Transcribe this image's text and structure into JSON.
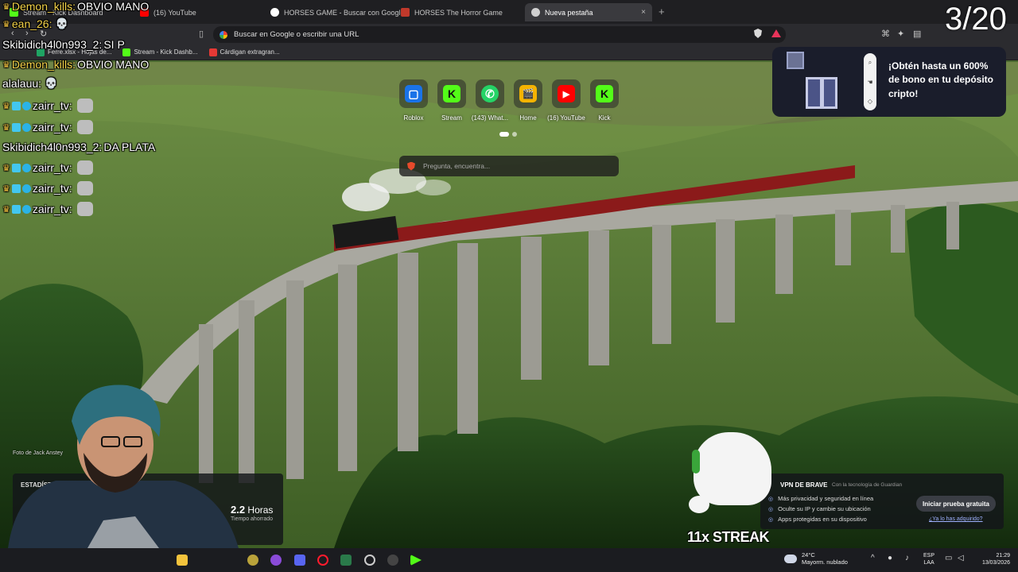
{
  "browser": {
    "tabs": [
      {
        "label": "Stream - Kick Dashboard",
        "favicon_color": "#53fc18"
      },
      {
        "label": "(16) YouTube",
        "favicon_color": "#ff0000"
      },
      {
        "label": "HORSES GAME - Buscar con Google",
        "favicon_color": "#4285f4"
      },
      {
        "label": "HORSES The Horror Game",
        "favicon_color": "#c0392b"
      },
      {
        "label": "Nueva pestaña",
        "favicon_color": "#d0d0d0",
        "active": true
      }
    ],
    "new_tab_symbol": "+",
    "close_symbol": "×",
    "url_placeholder": "Buscar en Google o escribir una URL",
    "bookmarks": [
      {
        "label": "Ferre.xlsx - Hojas de...",
        "icon": "sheets-icon",
        "color": "#1fa463"
      },
      {
        "label": "Stream - Kick Dashb...",
        "icon": "kick-icon",
        "color": "#53fc18"
      },
      {
        "label": "Cárdigan extragran...",
        "icon": "shop-icon",
        "color": "#e53935"
      }
    ]
  },
  "new_tab": {
    "shortcuts": [
      {
        "label": "Roblox",
        "color": "#1a73e8",
        "glyph": "▢"
      },
      {
        "label": "Stream",
        "color": "#53fc18",
        "glyph": "K"
      },
      {
        "label": "(143) What...",
        "color": "#25d366",
        "glyph": "✆"
      },
      {
        "label": "Home",
        "color": "#f5b301",
        "glyph": "🎬"
      },
      {
        "label": "(16) YouTube",
        "color": "#ff0000",
        "glyph": "▶"
      },
      {
        "label": "Kick",
        "color": "#53fc18",
        "glyph": "K"
      }
    ],
    "ask_placeholder": "Pregunta, encuentra...",
    "photo_credit": "Foto de Jack Anstey"
  },
  "ad": {
    "text": "¡Obtén hasta un 600% de bono en tu depósito cripto!"
  },
  "chat": [
    {
      "user": "Demon_kills:",
      "message": "OBVIO MANO",
      "gold": true,
      "badge": "crown"
    },
    {
      "user": "ean_26:",
      "message": "",
      "gold": true,
      "badge": "crown",
      "emote": "skull"
    },
    {
      "user": "Skibidich4l0n993_2:",
      "message": "SI P",
      "gold": false
    },
    {
      "user": "Demon_kills:",
      "message": "OBVIO MANO",
      "gold": true,
      "badge": "crown"
    },
    {
      "user": "alalauu:",
      "message": "",
      "gold": false,
      "emote": "skull"
    },
    {
      "user": "zairr_tv:",
      "message": "",
      "gold": false,
      "badge": "sub",
      "emote": "cat"
    },
    {
      "user": "zairr_tv:",
      "message": "",
      "gold": false,
      "badge": "sub",
      "emote": "cat"
    },
    {
      "user": "Skibidich4l0n993_2:",
      "message": "DA PLATA",
      "gold": false
    },
    {
      "user": "zairr_tv:",
      "message": "",
      "gold": false,
      "badge": "sub",
      "emote": "cat"
    },
    {
      "user": "zairr_tv:",
      "message": "",
      "gold": false,
      "badge": "sub",
      "emote": "cat"
    },
    {
      "user": "zairr_tv:",
      "message": "",
      "gold": false,
      "badge": "sub",
      "emote": "cat"
    }
  ],
  "counter": "3/20",
  "stats": {
    "heading": "ESTADÍSTI",
    "value": "2.2",
    "unit": "Horas",
    "caption": "Tiempo ahorrado"
  },
  "vpn": {
    "title": "VPN DE BRAVE",
    "powered": "Con la tecnología de Guardian",
    "features": [
      "Más privacidad y seguridad en línea",
      "Oculte su IP y cambie su ubicación",
      "Apps protegidas en su dispositivo"
    ],
    "cta": "Iniciar prueba gratuita",
    "already": "¿Ya lo has adquirido?"
  },
  "streak": "11x STREAK",
  "taskbar": {
    "temperature": "24°C",
    "weather": "Mayorm. nublado",
    "lang": "ESP",
    "region": "LAA",
    "time": "21:29",
    "date": "13/03/2026"
  }
}
